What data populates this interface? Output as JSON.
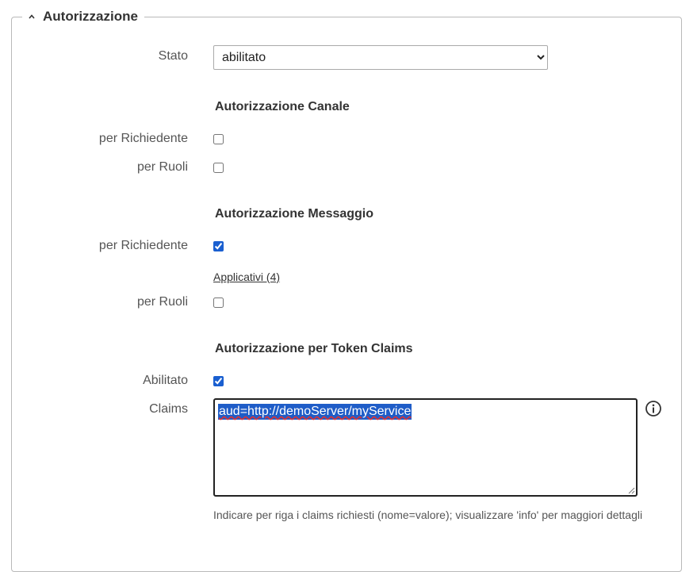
{
  "section": {
    "title": "Autorizzazione"
  },
  "stato": {
    "label": "Stato",
    "value": "abilitato"
  },
  "canale": {
    "title": "Autorizzazione Canale",
    "per_richiedente_label": "per Richiedente",
    "per_richiedente_checked": false,
    "per_ruoli_label": "per Ruoli",
    "per_ruoli_checked": false
  },
  "messaggio": {
    "title": "Autorizzazione Messaggio",
    "per_richiedente_label": "per Richiedente",
    "per_richiedente_checked": true,
    "applicativi_link": "Applicativi (4)",
    "per_ruoli_label": "per Ruoli",
    "per_ruoli_checked": false
  },
  "token_claims": {
    "title": "Autorizzazione per Token Claims",
    "abilitato_label": "Abilitato",
    "abilitato_checked": true,
    "claims_label": "Claims",
    "claims_value": "aud=http://demoServer/myService",
    "hint": "Indicare per riga i claims richiesti (nome=valore); visualizzare 'info' per maggiori dettagli"
  },
  "icons": {
    "collapse": "chevron-up-icon",
    "info": "info-icon"
  },
  "colors": {
    "accent": "#1a5fd0",
    "selection": "#1f5dc8"
  }
}
